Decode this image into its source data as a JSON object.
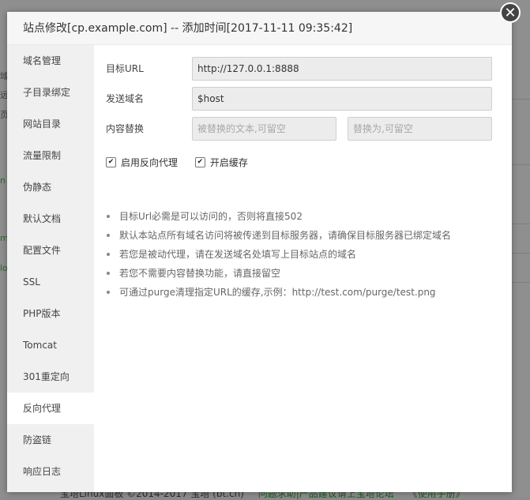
{
  "background": {
    "glyphs": [
      "域",
      "远",
      "页",
      "n",
      "m",
      "lo",
      "11"
    ],
    "footer": {
      "copyright": "宝塔Linux面板 ©2014-2017 宝塔 (bt.cn)",
      "link1": "问题求助|产品建议请上宝塔论坛",
      "link2": "《使用手册》"
    }
  },
  "modal": {
    "title": "站点修改[cp.example.com] -- 添加时间[2017-11-11 09:35:42]",
    "close_symbol": "✕"
  },
  "sidebar": {
    "items": [
      {
        "label": "域名管理"
      },
      {
        "label": "子目录绑定"
      },
      {
        "label": "网站目录"
      },
      {
        "label": "流量限制"
      },
      {
        "label": "伪静态"
      },
      {
        "label": "默认文档"
      },
      {
        "label": "配置文件"
      },
      {
        "label": "SSL"
      },
      {
        "label": "PHP版本"
      },
      {
        "label": "Tomcat"
      },
      {
        "label": "301重定向"
      },
      {
        "label": "反向代理"
      },
      {
        "label": "防盗链"
      },
      {
        "label": "响应日志"
      }
    ],
    "active_index": 11
  },
  "form": {
    "target_url": {
      "label": "目标URL",
      "value": "http://127.0.0.1:8888"
    },
    "send_domain": {
      "label": "发送域名",
      "value": "$host"
    },
    "replace": {
      "label": "内容替换",
      "from_placeholder": "被替换的文本,可留空",
      "to_placeholder": "替换为,可留空"
    },
    "enable_proxy": {
      "label": "启用反向代理",
      "checked": true
    },
    "enable_cache": {
      "label": "开启缓存",
      "checked": true
    }
  },
  "tips": [
    "目标Url必需是可以访问的，否则将直接502",
    "默认本站点所有域名访问将被传递到目标服务器，请确保目标服务器已绑定域名",
    "若您是被动代理，请在发送域名处填写上目标站点的域名",
    "若您不需要内容替换功能，请直接留空",
    "可通过purge清理指定URL的缓存,示例：http://test.com/purge/test.png"
  ],
  "colors": {
    "overlay": "#8f8f8f",
    "sidebar_bg": "#f0f0f0",
    "input_bg": "#ececec",
    "close_bg": "#444444"
  }
}
